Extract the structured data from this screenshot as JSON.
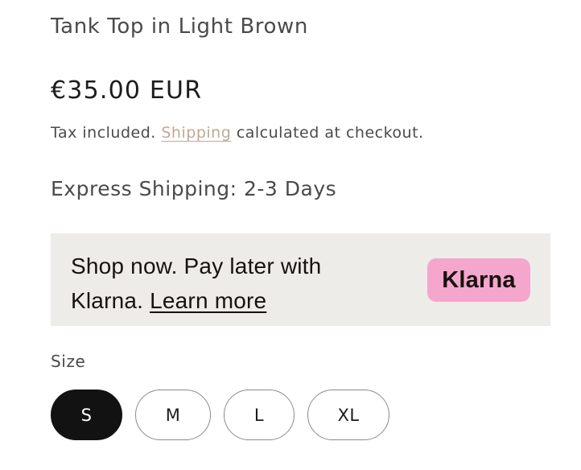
{
  "product": {
    "title": "Tank Top in Light Brown",
    "price": "€35.00 EUR",
    "tax_prefix": "Tax included.",
    "shipping_link": "Shipping",
    "tax_suffix": "calculated at checkout.",
    "express_shipping": "Express Shipping: 2-3 Days"
  },
  "klarna": {
    "message": "Shop now. Pay later with Klarna.",
    "learn_more": "Learn more",
    "badge": "Klarna",
    "badge_color": "#f4a6cc",
    "box_color": "#eeece9"
  },
  "size": {
    "label": "Size",
    "options": [
      "S",
      "M",
      "L",
      "XL"
    ],
    "selected": "S"
  },
  "colors": {
    "link": "#c4a796",
    "selected_bg": "#121212"
  }
}
